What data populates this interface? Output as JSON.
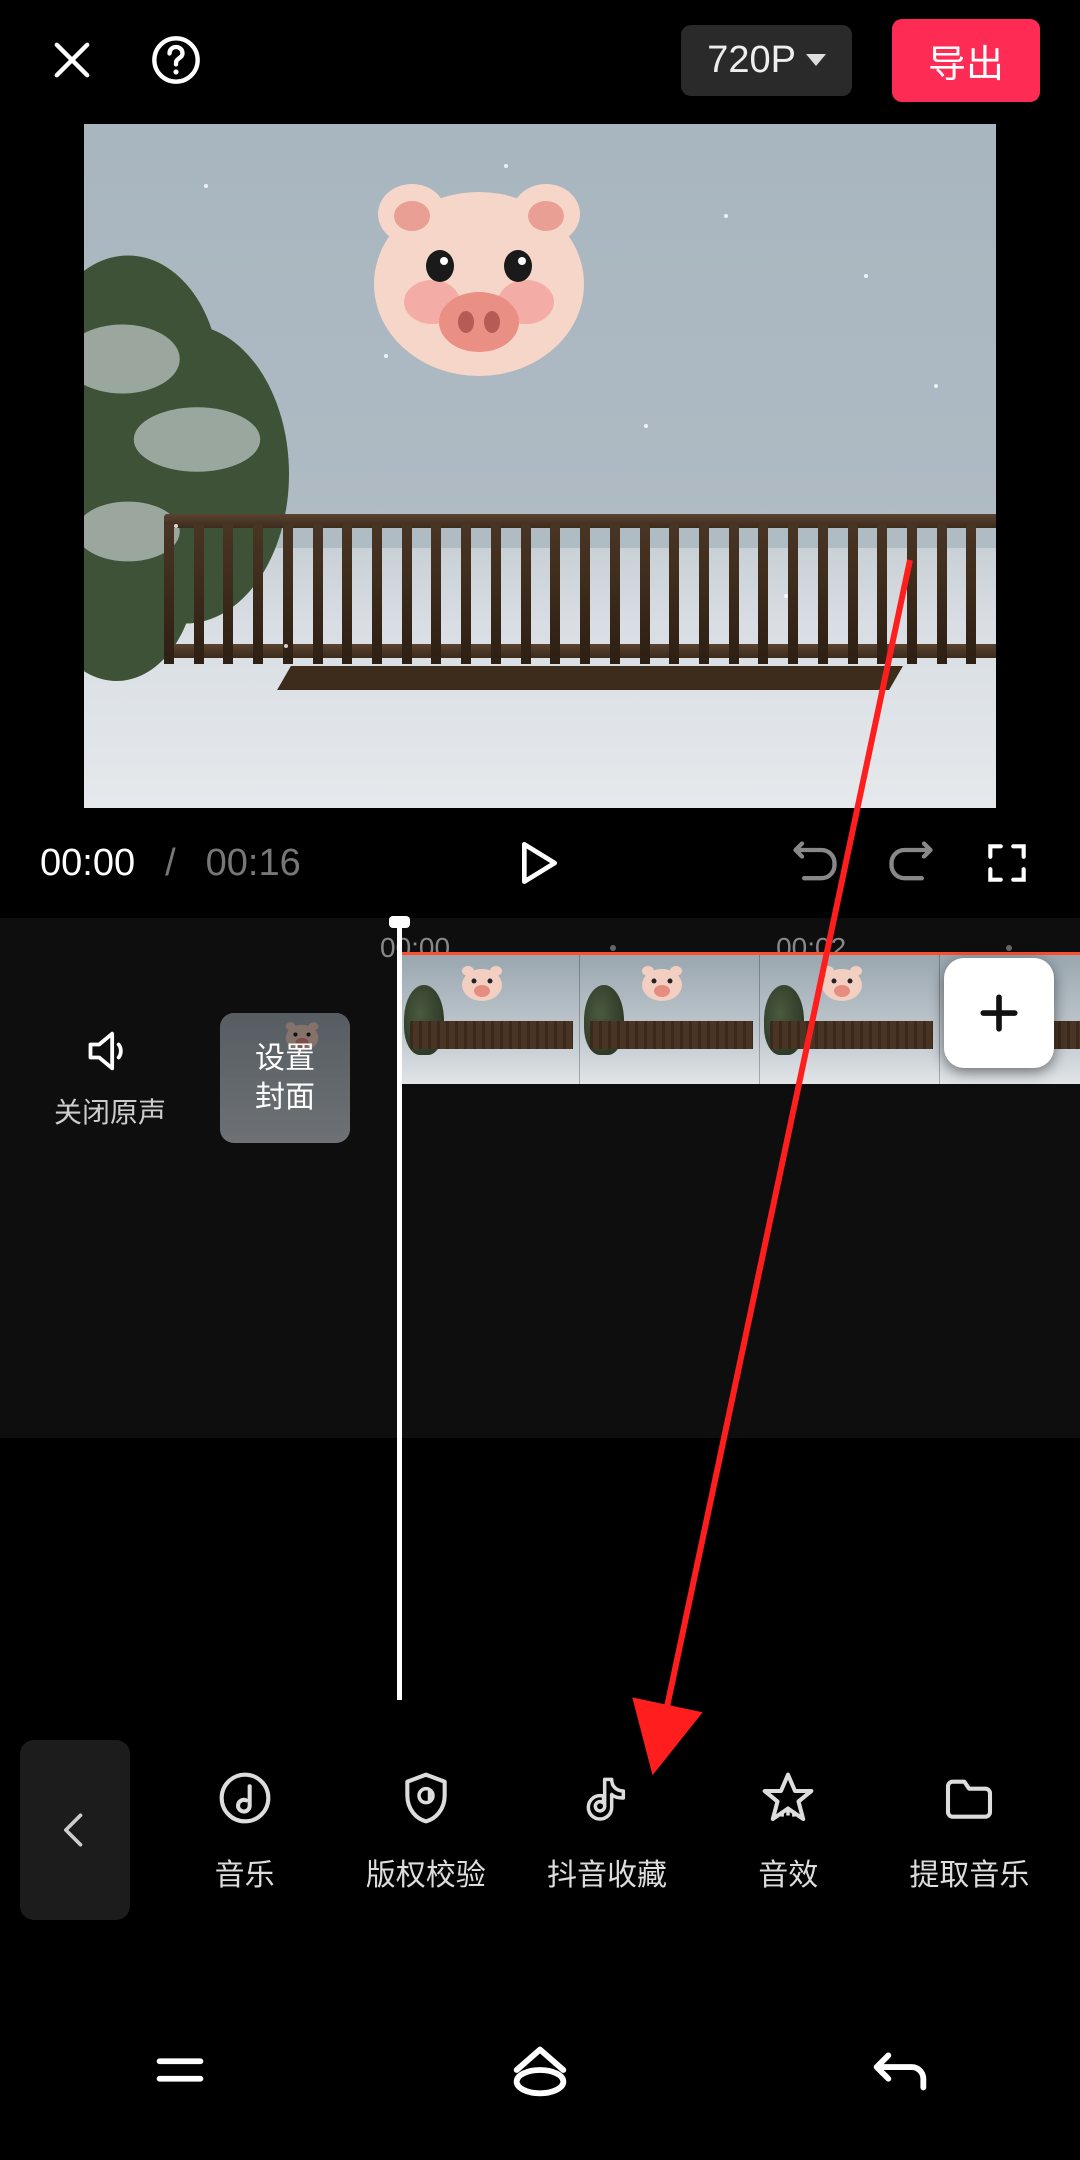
{
  "header": {
    "quality_label": "720P",
    "export_label": "导出"
  },
  "player": {
    "current_time": "00:00",
    "separator": "/",
    "total_time": "00:16"
  },
  "ruler": {
    "tick_0": "00:00",
    "tick_1": "00:02"
  },
  "track": {
    "mute_label": "关闭原声",
    "cover_label_line1": "设置",
    "cover_label_line2": "封面"
  },
  "tools": {
    "music": "音乐",
    "copyright": "版权校验",
    "douyin_fav": "抖音收藏",
    "sound_fx": "音效",
    "extract_music": "提取音乐"
  }
}
